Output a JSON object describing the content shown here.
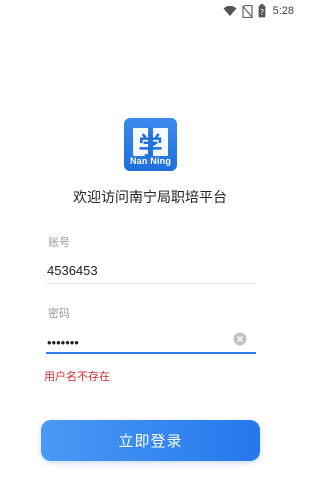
{
  "status_bar": {
    "time": "5:28",
    "icons": [
      "wifi-icon",
      "no-sim-icon",
      "battery-icon"
    ]
  },
  "logo": {
    "glyph": "学",
    "text": "Nan Ning",
    "color": "#2f7ff0"
  },
  "welcome_text": "欢迎访问南宁局职培平台",
  "account": {
    "label": "账号",
    "value": "4536453"
  },
  "password": {
    "label": "密码",
    "value": "1234567"
  },
  "error_message": "用户名不存在",
  "login_button": "立即登录",
  "colors": {
    "accent": "#2f7ff0",
    "error": "#d42c2c"
  }
}
